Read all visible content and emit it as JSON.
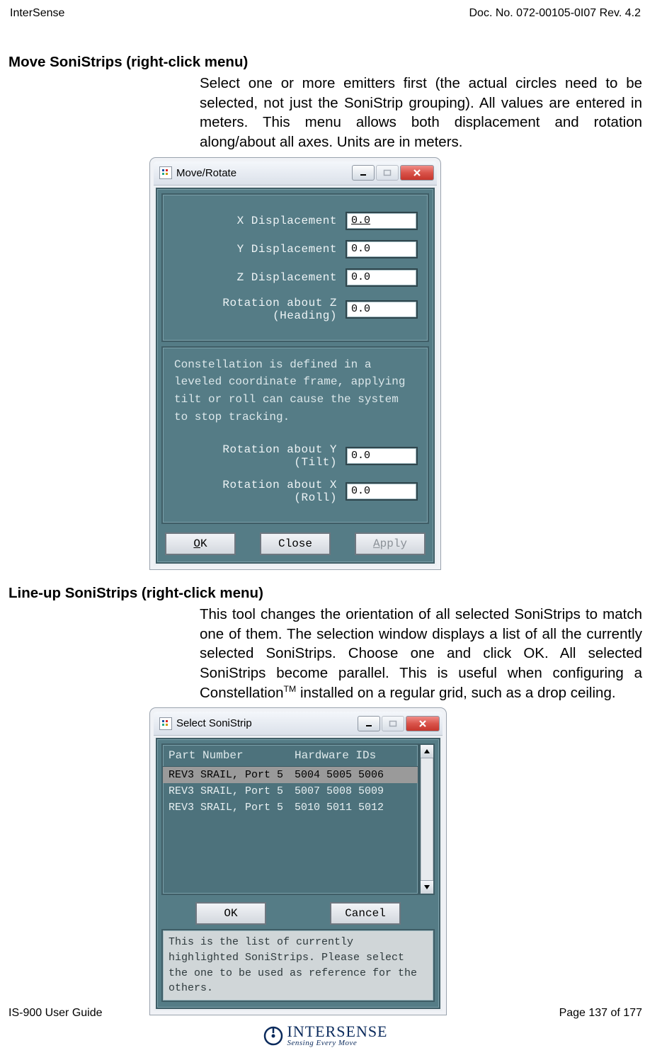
{
  "header": {
    "left": "InterSense",
    "right": "Doc. No. 072-00105-0I07 Rev. 4.2"
  },
  "section1": {
    "heading": "Move SoniStrips (right-click menu)",
    "text": "Select one or more emitters first (the actual circles need to be selected, not just the SoniStrip grouping).  All values are entered in meters.  This menu allows both displacement and rotation along/about all axes.  Units are in meters."
  },
  "dialog1": {
    "title": "Move/Rotate",
    "fields": {
      "x": {
        "label": "X Displacement",
        "value": "0.0"
      },
      "y": {
        "label": "Y Displacement",
        "value": "0.0"
      },
      "z": {
        "label": "Z Displacement",
        "value": "0.0"
      },
      "rz": {
        "label": "Rotation about Z (Heading)",
        "value": "0.0"
      }
    },
    "warning": "Constellation is defined in a leveled coordinate frame, applying tilt or roll can cause the system to stop tracking.",
    "fields2": {
      "ry": {
        "label": "Rotation about Y (Tilt)",
        "value": "0.0"
      },
      "rx": {
        "label": "Rotation about X (Roll)",
        "value": "0.0"
      }
    },
    "buttons": {
      "ok": "OK",
      "ok_ul": "O",
      "ok_rest": "K",
      "close": "Close",
      "apply": "Apply",
      "apply_ul": "A",
      "apply_rest": "pply"
    }
  },
  "section2": {
    "heading": "Line-up SoniStrips (right-click menu)",
    "text_a": "This tool changes the orientation of all selected SoniStrips to match one of them.  The selection window displays a list of all the currently selected SoniStrips.  Choose one and click OK.  All selected SoniStrips become parallel.  This is useful when configuring a Constellation",
    "text_b": " installed on a regular grid, such as a drop ceiling."
  },
  "dialog2": {
    "title": "Select SoniStrip",
    "columns": {
      "part": "Part Number",
      "hw": "Hardware IDs"
    },
    "rows": [
      {
        "part": "REV3 SRAIL, Port 5",
        "hw": "5004 5005 5006",
        "selected": true
      },
      {
        "part": "REV3 SRAIL, Port 5",
        "hw": "5007 5008 5009",
        "selected": false
      },
      {
        "part": "REV3 SRAIL, Port 5",
        "hw": "5010 5011 5012",
        "selected": false
      }
    ],
    "buttons": {
      "ok": "OK",
      "cancel": "Cancel"
    },
    "footnote": "This is the list of currently highlighted SoniStrips. Please select the one to be used as reference for the others."
  },
  "footer": {
    "left": "IS-900 User Guide",
    "right": "Page 137 of 177",
    "logo1": "INTERSENSE",
    "logo2": "Sensing Every Move"
  }
}
